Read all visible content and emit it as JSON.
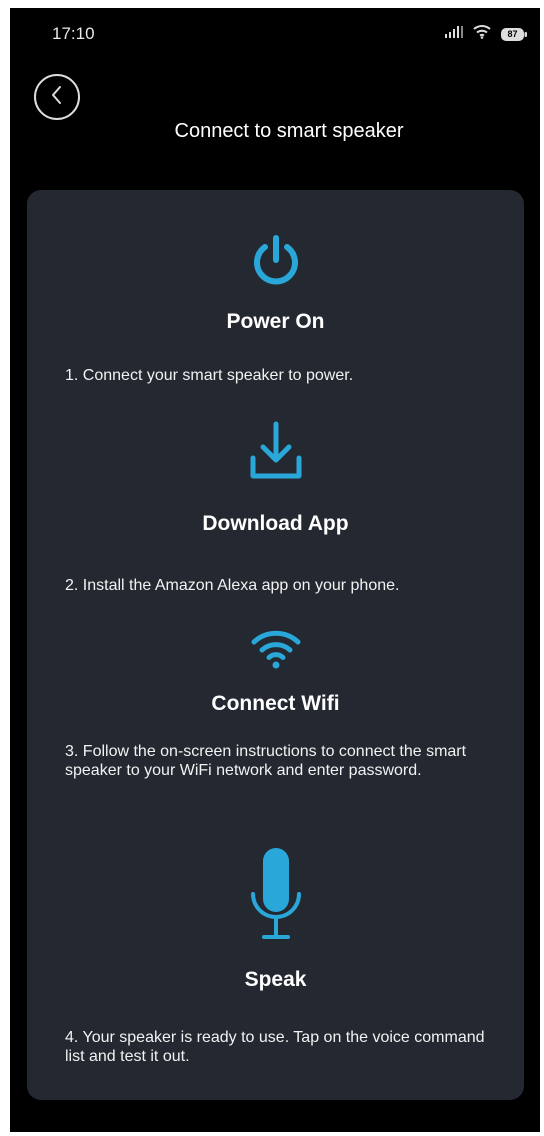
{
  "status_bar": {
    "time": "17:10",
    "battery": "87",
    "icons": [
      "signal-icon",
      "wifi-icon",
      "battery-icon"
    ]
  },
  "header": {
    "back_icon": "chevron-left-icon",
    "title": "Connect to smart speaker"
  },
  "colors": {
    "background": "#000000",
    "card": "#232831",
    "accent": "#2aa7d9",
    "text": "#ffffff"
  },
  "steps": [
    {
      "icon": "power-icon",
      "title": "Power On",
      "description": "1. Connect your smart speaker to power."
    },
    {
      "icon": "download-icon",
      "title": "Download App",
      "description": "2. Install the Amazon Alexa app on your phone."
    },
    {
      "icon": "wifi-icon",
      "title": "Connect Wifi",
      "description": "3. Follow the on-screen instructions to connect the smart speaker to your WiFi network and enter password."
    },
    {
      "icon": "microphone-icon",
      "title": "Speak",
      "description": "4. Your speaker is ready to use. Tap on the voice command list and test it out."
    }
  ]
}
